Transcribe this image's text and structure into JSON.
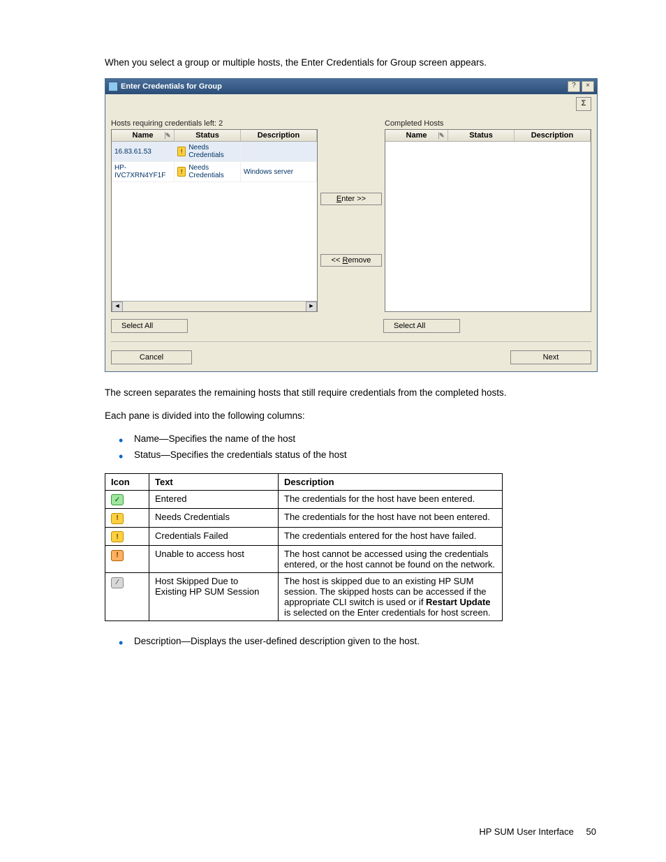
{
  "intro": "When you select a group or multiple hosts, the Enter Credentials for Group screen appears.",
  "dialog": {
    "title": "Enter Credentials for Group",
    "helpBtn": "?",
    "closeBtn": "×",
    "sigma": "Σ",
    "left": {
      "label": "Hosts requiring credentials left: 2",
      "headers": {
        "name": "Name",
        "status": "Status",
        "desc": "Description"
      },
      "rows": [
        {
          "name": "16.83.61.53",
          "status": "Needs Credentials",
          "desc": ""
        },
        {
          "name": "HP-IVC7XRN4YF1F",
          "status": "Needs Credentials",
          "desc": "Windows server"
        }
      ],
      "selectAll": "Select All"
    },
    "right": {
      "label": "Completed Hosts",
      "headers": {
        "name": "Name",
        "status": "Status",
        "desc": "Description"
      },
      "selectAll": "Select All"
    },
    "enterBtnPrefix": "E",
    "enterBtnSuffix": "nter >>",
    "removeBtnPrefix": "<< ",
    "removeBtnUl": "R",
    "removeBtnSuffix": "emove",
    "cancelUl": "C",
    "cancelSuffix": "ancel",
    "nextUl": "N",
    "nextSuffix": "ext",
    "selectAllUl": "S",
    "selectAllRightUl": "A"
  },
  "para2": "The screen separates the remaining hosts that still require credentials from the completed hosts.",
  "para3": "Each pane is divided into the following columns:",
  "bullets1": [
    "Name—Specifies the name of the host",
    "Status—Specifies the credentials status of the host"
  ],
  "tableHeaders": {
    "icon": "Icon",
    "text": "Text",
    "desc": "Description"
  },
  "tableRows": [
    {
      "icon": "entered",
      "iconGlyph": "✓",
      "text": "Entered",
      "desc": "The credentials for the host have been entered."
    },
    {
      "icon": "warn",
      "iconGlyph": "!",
      "text": "Needs Credentials",
      "desc": "The credentials for the host have not been entered."
    },
    {
      "icon": "warn",
      "iconGlyph": "!",
      "text": "Credentials Failed",
      "desc": "The credentials entered for the host have failed."
    },
    {
      "icon": "unable",
      "iconGlyph": "!",
      "text": "Unable to access host",
      "desc": "The host cannot be accessed using the credentials entered, or the host cannot be found on the network."
    },
    {
      "icon": "skip",
      "iconGlyph": "⁄",
      "text": "Host Skipped Due to Existing HP SUM Session",
      "descPrefix": "The host is skipped due to an existing HP SUM session. The skipped hosts can be accessed if the appropriate CLI switch is used or if ",
      "descBold": "Restart Update",
      "descSuffix": " is selected on the Enter credentials for host screen."
    }
  ],
  "bullets2": [
    "Description—Displays the user-defined description given to the host."
  ],
  "footer": {
    "text": "HP SUM User Interface",
    "page": "50"
  }
}
